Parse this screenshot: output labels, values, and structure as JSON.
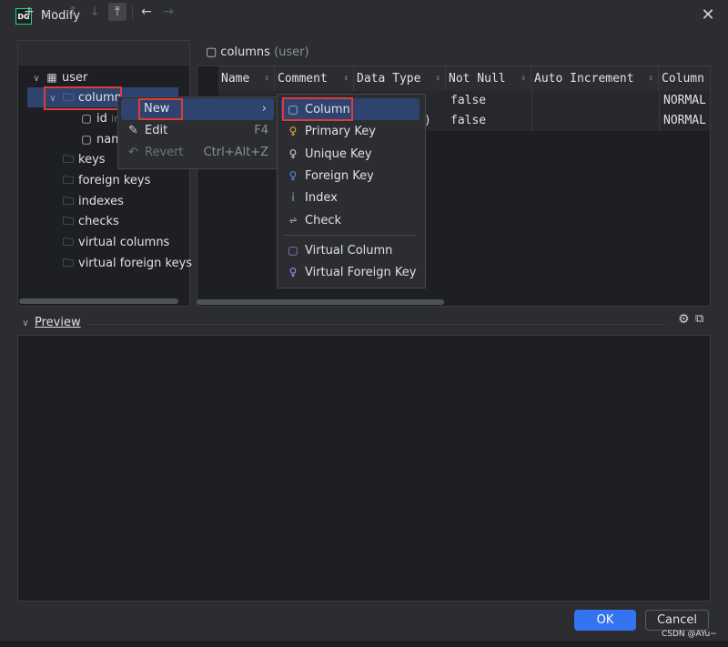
{
  "window": {
    "title": "Modify",
    "logo_text": "DG",
    "close_glyph": "✕"
  },
  "toolbar": {
    "add": "+",
    "remove": "—",
    "move_up": "↑",
    "move_down": "↓",
    "move_top": "⤒",
    "back": "←",
    "forward": "→"
  },
  "tree": {
    "root": "user",
    "column_folder": "column",
    "column_children": [
      {
        "name": "id",
        "hint": "int"
      },
      {
        "name": "nam",
        "hint": ""
      }
    ],
    "folders": [
      "keys",
      "foreign keys",
      "indexes",
      "checks",
      "virtual columns",
      "virtual foreign keys"
    ]
  },
  "columns_panel": {
    "title": "columns",
    "subtitle": "(user)"
  },
  "table": {
    "headers": [
      "Name",
      "Comment",
      "Data Type",
      "Not Null",
      "Auto Increment",
      "Column"
    ],
    "rows": [
      {
        "type_tail": "",
        "not_null": "false",
        "kind": "NORMAL"
      },
      {
        "type_tail": ")",
        "not_null": "false",
        "kind": "NORMAL"
      }
    ]
  },
  "context_menu": {
    "items": [
      {
        "label": "New",
        "shortcut": "",
        "arrow": "›"
      },
      {
        "label": "Edit",
        "shortcut": "F4"
      },
      {
        "label": "Revert",
        "shortcut": "Ctrl+Alt+Z"
      }
    ]
  },
  "submenu": {
    "items": [
      "Column",
      "Primary Key",
      "Unique Key",
      "Foreign Key",
      "Index",
      "Check"
    ],
    "virtual_items": [
      "Virtual Column",
      "Virtual Foreign Key"
    ]
  },
  "preview": {
    "label": "Preview"
  },
  "buttons": {
    "ok": "OK",
    "cancel": "Cancel"
  },
  "watermark": "CSDN @AYu~",
  "colors": {
    "accent": "#3574f0",
    "selection": "#2e436e",
    "highlight_box": "#e03b3b",
    "folder": "#7eb0ec",
    "key": "#e8b043"
  }
}
